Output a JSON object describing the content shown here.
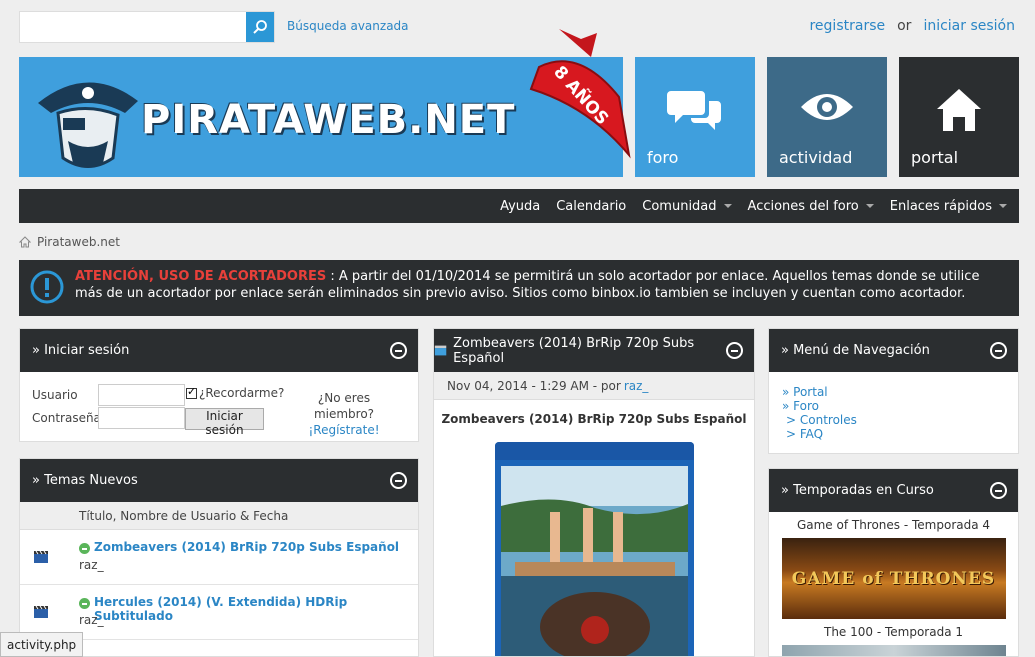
{
  "search": {
    "placeholder": "",
    "advanced_label": "Búsqueda avanzada"
  },
  "auth": {
    "register": "registrarse",
    "separator": "or",
    "login": "iniciar sesión"
  },
  "banner": {
    "logo": "PIRATAWEB.NET",
    "ribbon": "8 AÑOS"
  },
  "tiles": [
    {
      "label": "foro",
      "icon": "chat-bubbles-icon"
    },
    {
      "label": "actividad",
      "icon": "eye-icon"
    },
    {
      "label": "portal",
      "icon": "home-icon"
    }
  ],
  "nav": {
    "items": [
      "Ayuda",
      "Calendario",
      "Comunidad",
      "Acciones del foro",
      "Enlaces rápidos"
    ]
  },
  "breadcrumb": {
    "home": "Pirataweb.net"
  },
  "notice": {
    "title": "ATENCIÓN, USO DE ACORTADORES",
    "body": " : A partir del 01/10/2014 se permitirá un solo acortador por enlace. Aquellos temas donde se utilice más de un acortador por enlace serán eliminados sin previo aviso. Sitios como binbox.io tambien se incluyen y cuentan como acortador."
  },
  "login": {
    "heading": "» Iniciar sesión",
    "user_label": "Usuario",
    "pass_label": "Contraseña",
    "remember": "¿Recordarme?",
    "button": "Iniciar sesión",
    "not_member": "¿No eres miembro?",
    "register": "¡Regístrate!"
  },
  "topics": {
    "heading": "» Temas Nuevos",
    "columns": "Título, Nombre de Usuario & Fecha",
    "rows": [
      {
        "title": "Zombeavers (2014) BrRip 720p Subs Español",
        "user": "raz_"
      },
      {
        "title": "Hercules (2014) (V. Extendida) HDRip Subtitulado",
        "user": "raz_"
      }
    ]
  },
  "post": {
    "heading": "Zombeavers (2014) BrRip 720p Subs Español",
    "date": "Nov 04, 2014 - 1:29 AM - por",
    "author": "raz_",
    "title": "Zombeavers (2014) BrRip 720p Subs Español"
  },
  "menu": {
    "heading": "» Menú de Navegación",
    "items": [
      "» Portal",
      "» Foro",
      "> Controles",
      "> FAQ"
    ]
  },
  "seasons": {
    "heading": "» Temporadas en Curso",
    "items": [
      {
        "label": "Game of Thrones - Temporada 4",
        "image_text": "GAME of THRONES"
      },
      {
        "label": "The 100 - Temporada 1"
      }
    ]
  },
  "status_bar": {
    "url": "activity.php"
  },
  "colors": {
    "accent": "#3f9fdd",
    "dark": "#2b2e30",
    "link": "#2b86c5",
    "warning": "#e8403a"
  }
}
